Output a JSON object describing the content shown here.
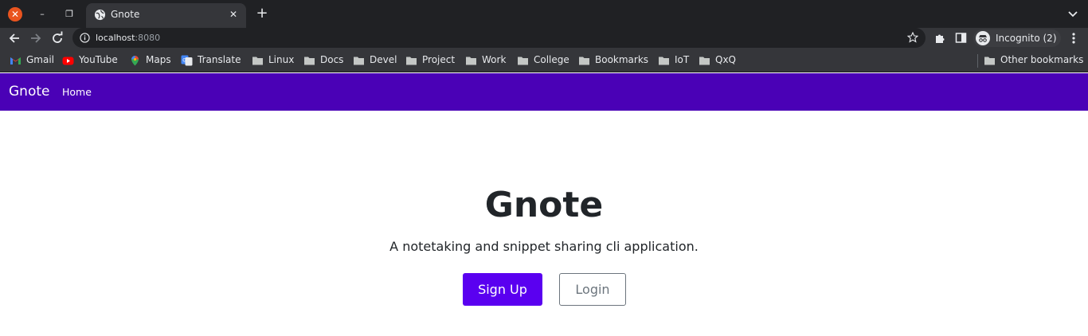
{
  "window": {
    "close_glyph": "✕",
    "minimize_glyph": "–",
    "restore_glyph": "❐"
  },
  "tab": {
    "title": "Gnote",
    "close_glyph": "✕"
  },
  "new_tab_glyph": "+",
  "toolbar": {
    "url_host": "localhost",
    "url_port": ":8080",
    "profile_label": "Incognito (2)"
  },
  "bookmarks": {
    "items": [
      {
        "label": "Gmail",
        "icon": "gmail-icon"
      },
      {
        "label": "YouTube",
        "icon": "youtube-icon"
      },
      {
        "label": "Maps",
        "icon": "maps-icon"
      },
      {
        "label": "Translate",
        "icon": "translate-icon"
      },
      {
        "label": "Linux",
        "icon": "folder-icon"
      },
      {
        "label": "Docs",
        "icon": "folder-icon"
      },
      {
        "label": "Devel",
        "icon": "folder-icon"
      },
      {
        "label": "Project",
        "icon": "folder-icon"
      },
      {
        "label": "Work",
        "icon": "folder-icon"
      },
      {
        "label": "College",
        "icon": "folder-icon"
      },
      {
        "label": "Bookmarks",
        "icon": "folder-icon"
      },
      {
        "label": "IoT",
        "icon": "folder-icon"
      },
      {
        "label": "QxQ",
        "icon": "folder-icon"
      }
    ],
    "other": "Other bookmarks"
  },
  "navbar": {
    "brand": "Gnote",
    "home": "Home"
  },
  "hero": {
    "title": "Gnote",
    "subtitle": "A notetaking and snippet sharing cli application.",
    "signup": "Sign Up",
    "login": "Login"
  },
  "colors": {
    "navbar": "#4a01b6",
    "primary_button": "#5a00f0",
    "browser_frame": "#202124",
    "toolbar": "#35363a"
  }
}
